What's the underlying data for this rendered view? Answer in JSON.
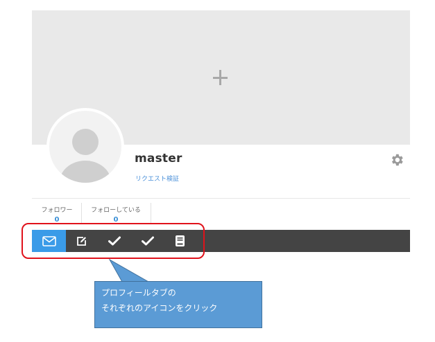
{
  "profile": {
    "username": "master",
    "verify_link": "リクエスト検証"
  },
  "stats": [
    {
      "label": "フォロワー",
      "count": "0"
    },
    {
      "label": "フォローしている",
      "count": "0"
    }
  ],
  "tabs": [
    {
      "icon": "mail-icon",
      "active": true
    },
    {
      "icon": "edit-icon",
      "active": false
    },
    {
      "icon": "check-icon",
      "active": false
    },
    {
      "icon": "check-icon",
      "active": false
    },
    {
      "icon": "book-icon",
      "active": false
    }
  ],
  "callout": {
    "line1": "プロフィールタブの",
    "line2": "それぞれのアイコンをクリック"
  },
  "colors": {
    "tab_active": "#3a9be8",
    "tab_bar": "#444444",
    "highlight": "#e0121b",
    "callout_bg": "#5b9bd5",
    "link": "#4a90d9"
  }
}
